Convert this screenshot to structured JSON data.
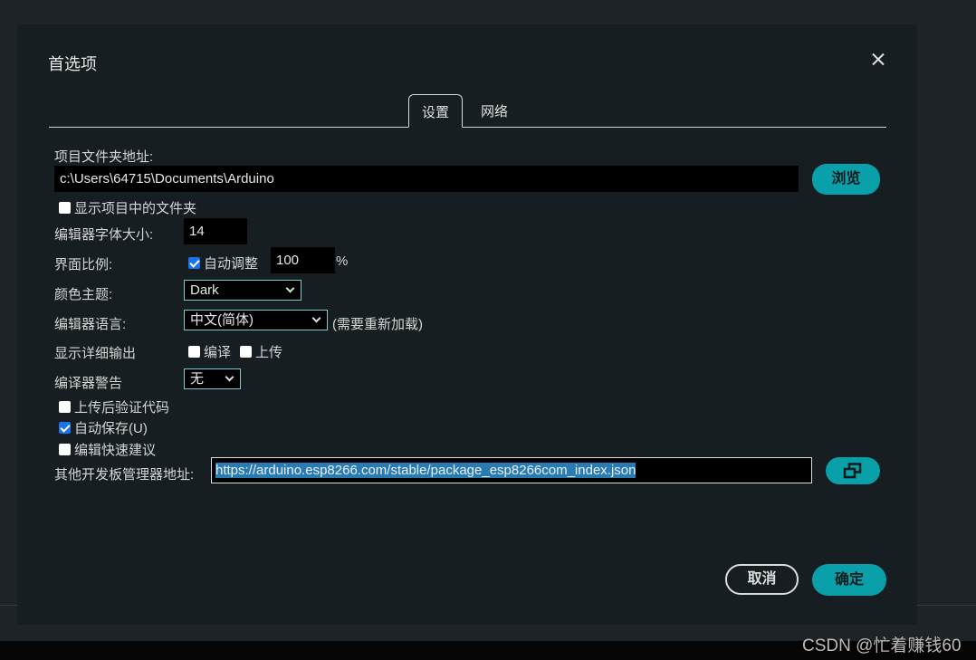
{
  "dialog": {
    "title": "首选项",
    "tabs": [
      {
        "label": "设置",
        "active": true
      },
      {
        "label": "网络",
        "active": false
      }
    ]
  },
  "settings": {
    "sketchbook_label": "项目文件夹地址:",
    "sketchbook_value": "c:\\Users\\64715\\Documents\\Arduino",
    "browse_label": "浏览",
    "show_files_label": "显示项目中的文件夹",
    "show_files_checked": false,
    "font_size_label": "编辑器字体大小:",
    "font_size_value": "14",
    "scale_label": "界面比例:",
    "auto_scale_label": "自动调整",
    "auto_scale_checked": true,
    "scale_value": "100",
    "scale_unit": "%",
    "theme_label": "颜色主题:",
    "theme_value": "Dark",
    "language_label": "编辑器语言:",
    "language_value": "中文(简体)",
    "language_note": "(需要重新加载)",
    "verbose_label": "显示详细输出",
    "verbose_compile_label": "编译",
    "verbose_compile_checked": false,
    "verbose_upload_label": "上传",
    "verbose_upload_checked": false,
    "warnings_label": "编译器警告",
    "warnings_value": "无",
    "verify_label": "上传后验证代码",
    "verify_checked": false,
    "autosave_label": "自动保存(U)",
    "autosave_checked": true,
    "quick_suggest_label": "编辑快速建议",
    "quick_suggest_checked": false,
    "board_urls_label": "其他开发板管理器地址:",
    "board_urls_value": "https://arduino.esp8266.com/stable/package_esp8266com_index.json"
  },
  "footer": {
    "cancel_label": "取消",
    "ok_label": "确定"
  },
  "watermark": "CSDN @忙着赚钱60",
  "colors": {
    "accent": "#0aa0aa",
    "background": "#171e21",
    "selection": "#2b7bb3"
  }
}
